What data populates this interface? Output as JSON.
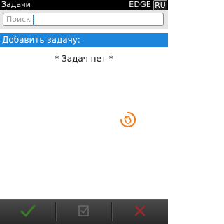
{
  "status_bar": {
    "app_title": "Задачи",
    "network": "EDGE",
    "input_language": "RU"
  },
  "search": {
    "placeholder": "Поиск",
    "value": ""
  },
  "task_list": {
    "add_task_label": "Добавить задачу:",
    "empty_message": "* Задач нет *"
  },
  "activity": {
    "icon": "busy-spinner-icon",
    "color": "#f07f1b"
  },
  "toolbar": {
    "buttons": [
      {
        "icon": "checkmark-icon",
        "color": "#3a7a2a"
      },
      {
        "icon": "task-list-icon",
        "color": "#6a6a6a"
      },
      {
        "icon": "delete-x-icon",
        "color": "#9a2a2a"
      }
    ]
  },
  "colors": {
    "status_bar_bg": "#000000",
    "header_bg": "#1b86dc",
    "toolbar_bg": "#3a3a3a"
  }
}
